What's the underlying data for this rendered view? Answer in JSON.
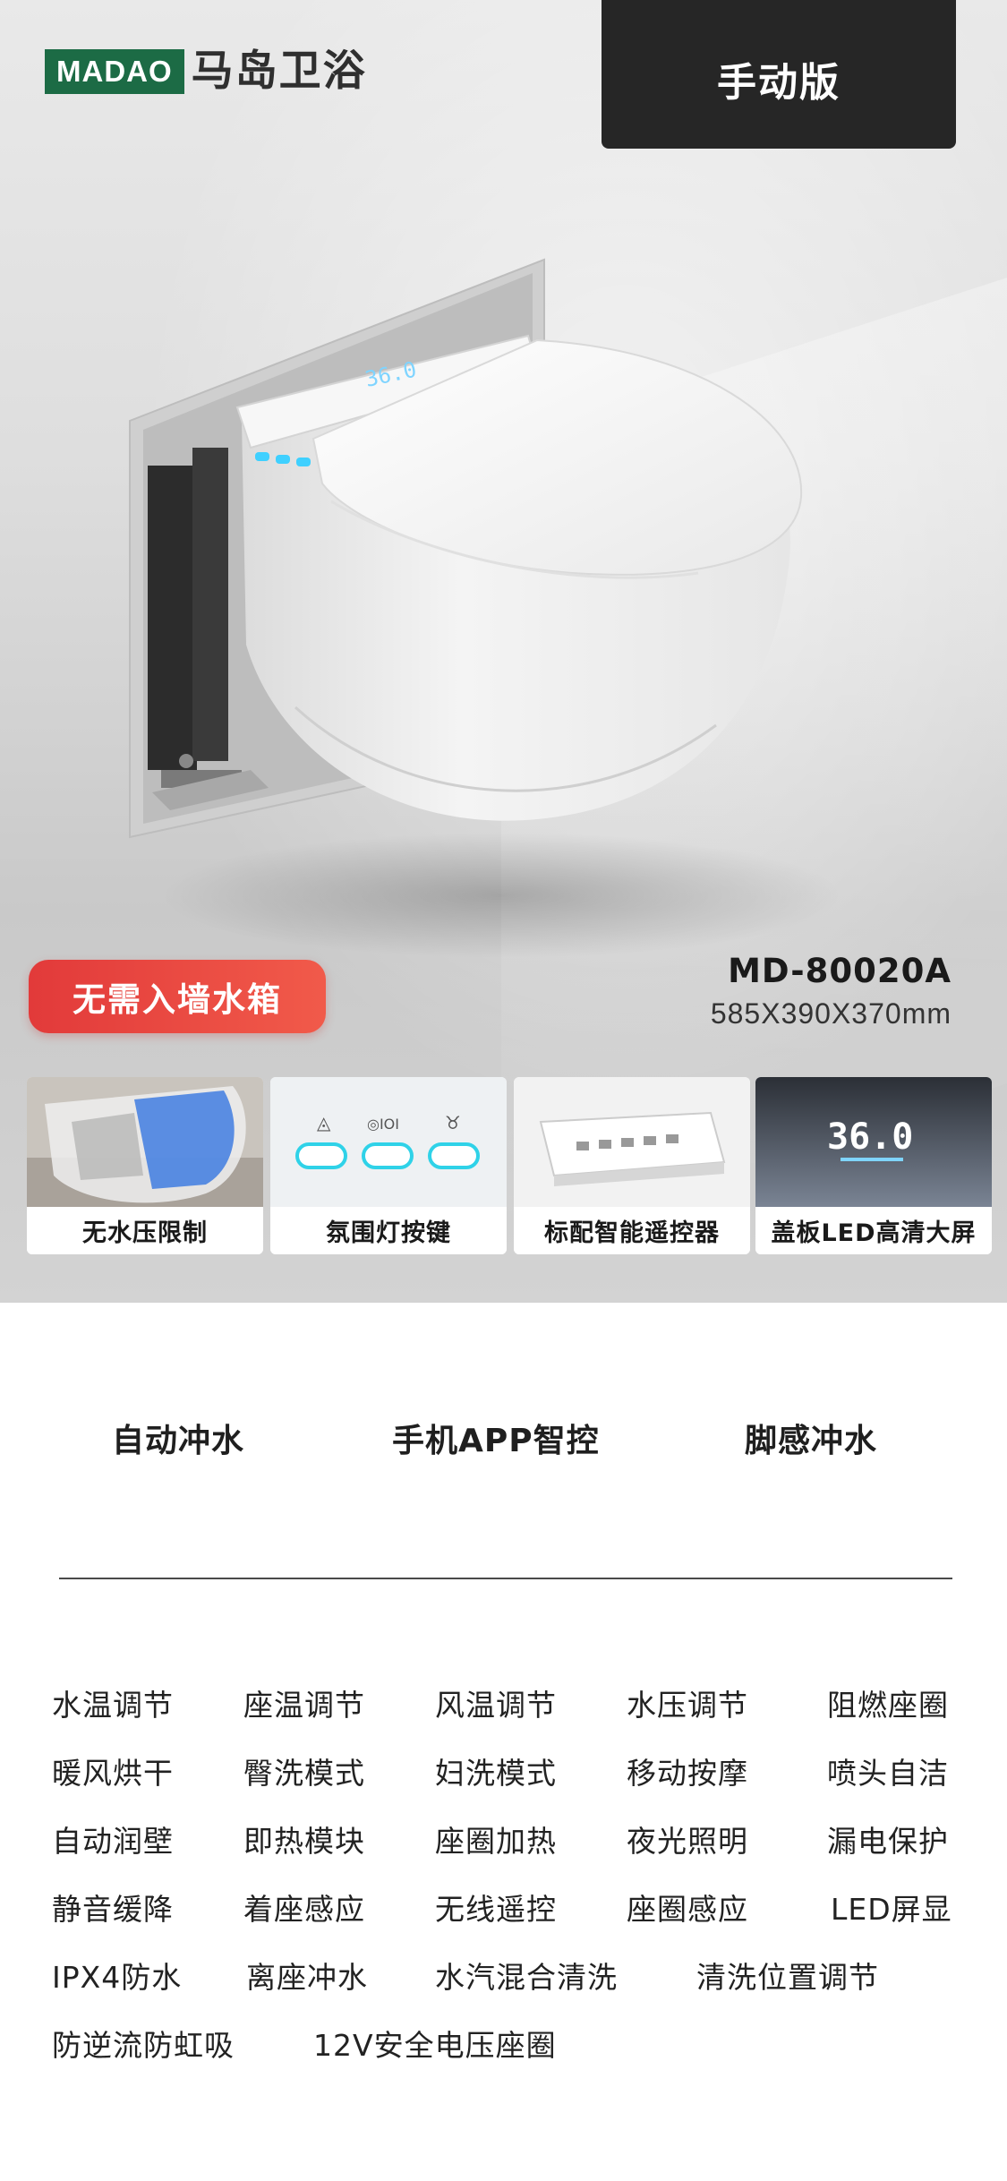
{
  "brand": {
    "logo_text": "MADAO",
    "logo_cn": "马岛卫浴",
    "brand_color": "#1c6b45"
  },
  "edition_label": "手动版",
  "hero": {
    "badge": "无需入墙水箱",
    "model_name": "MD-80020A",
    "model_size": "585X390X370mm",
    "display_readout": "36.0",
    "badge_color": "#e23a3a"
  },
  "thumbs": [
    {
      "caption": "无水压限制",
      "icon": "tank-cutaway-image"
    },
    {
      "caption": "氛围灯按键",
      "icon": "ambient-light-buttons-image"
    },
    {
      "caption": "标配智能遥控器",
      "icon": "remote-control-image"
    },
    {
      "caption": "盖板LED高清大屏",
      "icon": "led-display-image"
    }
  ],
  "top_features": [
    "自动冲水",
    "手机APP智控",
    "脚感冲水"
  ],
  "features": [
    [
      "水温调节",
      "座温调节",
      "风温调节",
      "水压调节",
      "阻燃座圈"
    ],
    [
      "暖风烘干",
      "臀洗模式",
      "妇洗模式",
      "移动按摩",
      "喷头自洁"
    ],
    [
      "自动润壁",
      "即热模块",
      "座圈加热",
      "夜光照明",
      "漏电保护"
    ],
    [
      "静音缓降",
      "着座感应",
      "无线遥控",
      "座圈感应",
      "LED屏显"
    ],
    [
      "IPX4防水",
      "离座冲水",
      "水汽混合清洗",
      "清洗位置调节"
    ],
    [
      "防逆流防虹吸",
      "12V安全电压座圈"
    ]
  ]
}
